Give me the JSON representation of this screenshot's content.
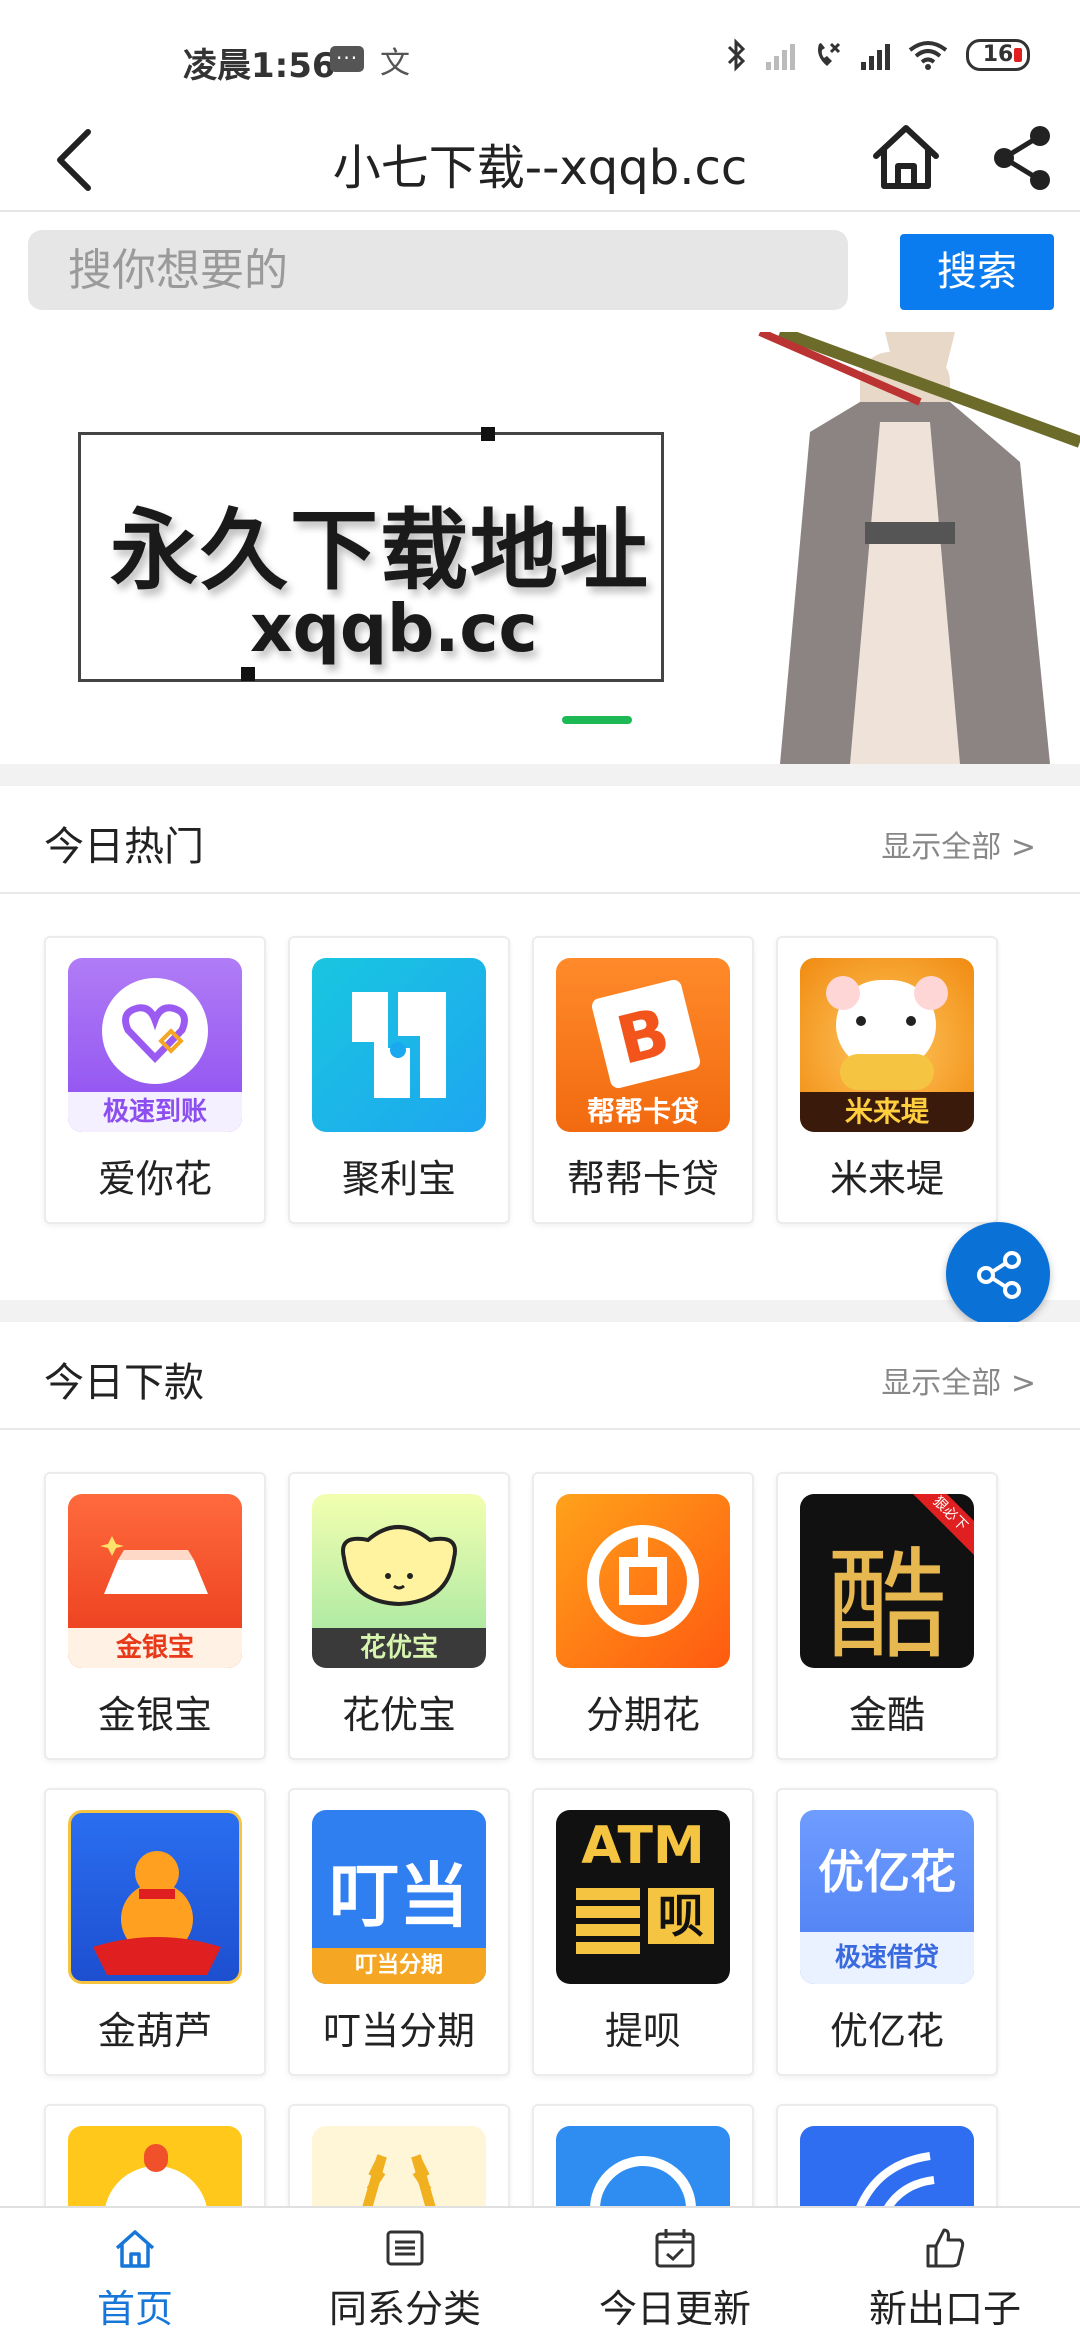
{
  "status_bar": {
    "time": "凌晨1:56",
    "wen_icon": "文",
    "battery": "16"
  },
  "header": {
    "title": "小七下载--xqqb.cc"
  },
  "search": {
    "placeholder": "搜你想要的",
    "button": "搜索"
  },
  "banner": {
    "title": "永久下载地址",
    "url": "xqqb.cc"
  },
  "hot": {
    "title": "今日热门",
    "show_all": "显示全部 >",
    "apps": [
      {
        "name": "爱你花",
        "icon": "heart-app-icon",
        "icon_label": "极速到账"
      },
      {
        "name": "聚利宝",
        "icon": "juli-app-icon"
      },
      {
        "name": "帮帮卡贷",
        "icon": "bangbang-app-icon",
        "icon_label": "帮帮卡贷"
      },
      {
        "name": "米来堤",
        "icon": "mouse-app-icon",
        "icon_label": "米来堤"
      }
    ]
  },
  "new": {
    "title": "今日下款",
    "show_all": "显示全部 >",
    "apps": [
      {
        "name": "金银宝",
        "icon": "gold-bar-app-icon",
        "icon_label": "金银宝"
      },
      {
        "name": "花优宝",
        "icon": "ingot-app-icon",
        "icon_label": "花优宝"
      },
      {
        "name": "分期花",
        "icon": "fenqi-app-icon"
      },
      {
        "name": "金酷",
        "icon": "ku-app-icon",
        "icon_text": "酷",
        "corner": "狠必下"
      },
      {
        "name": "金葫芦",
        "icon": "gourd-app-icon"
      },
      {
        "name": "叮当分期",
        "icon": "dingdang-app-icon",
        "icon_text": "叮当",
        "icon_label": "叮当分期"
      },
      {
        "name": "提呗",
        "icon": "atm-app-icon",
        "icon_text": "ATM",
        "icon_sub": "呗"
      },
      {
        "name": "优亿花",
        "icon": "youyi-app-icon",
        "icon_text": "优亿花",
        "icon_label": "极速借贷"
      }
    ]
  },
  "colors": {
    "accent": "#0a7cf0",
    "active_nav": "#1677d8",
    "indicator": "#1db954"
  },
  "nav": [
    {
      "label": "首页",
      "icon": "home-icon",
      "active": true
    },
    {
      "label": "同系分类",
      "icon": "list-icon"
    },
    {
      "label": "今日更新",
      "icon": "calendar-icon"
    },
    {
      "label": "新出口子",
      "icon": "thumbs-up-icon"
    }
  ]
}
